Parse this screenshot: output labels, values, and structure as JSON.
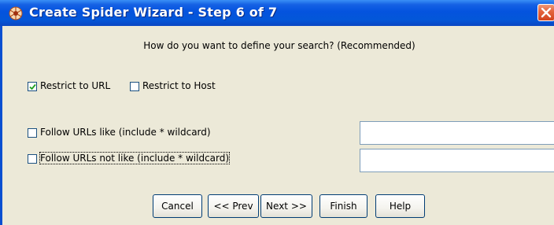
{
  "window": {
    "title": "Create Spider Wizard - Step 6 of 7",
    "icon": "spider-app-icon"
  },
  "main": {
    "question": "How do you want to define your search? (Recommended)",
    "options": {
      "restrict_url": {
        "label": "Restrict to URL",
        "checked": true
      },
      "restrict_host": {
        "label": "Restrict to Host",
        "checked": false
      },
      "follow_like": {
        "label": "Follow URLs like (include * wildcard)",
        "checked": false,
        "value": ""
      },
      "follow_not_like": {
        "label": "Follow URLs not like (include * wildcard)",
        "checked": false,
        "value": ""
      }
    }
  },
  "buttons": {
    "cancel": "Cancel",
    "prev": "<< Prev",
    "next": "Next >>",
    "finish": "Finish",
    "help": "Help"
  },
  "colors": {
    "titlebar": "#0453de",
    "dialog_bg": "#ece9d8",
    "close": "#d2441f"
  }
}
